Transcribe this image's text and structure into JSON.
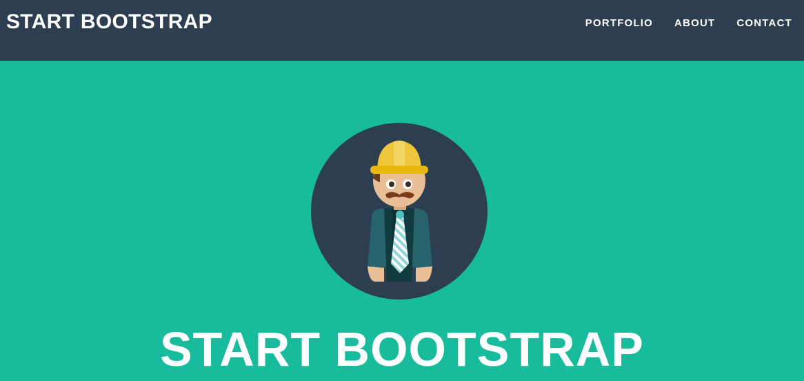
{
  "navbar": {
    "brand": "START BOOTSTRAP",
    "links": [
      {
        "label": "PORTFOLIO"
      },
      {
        "label": "ABOUT"
      },
      {
        "label": "CONTACT"
      }
    ]
  },
  "masthead": {
    "avatar_icon": "construction-worker-avatar-icon",
    "title": "START BOOTSTRAP"
  },
  "colors": {
    "navbar_bg": "#2c3e50",
    "masthead_bg": "#18bc9c",
    "avatar_circle": "#2c3e50",
    "text": "#ffffff"
  }
}
